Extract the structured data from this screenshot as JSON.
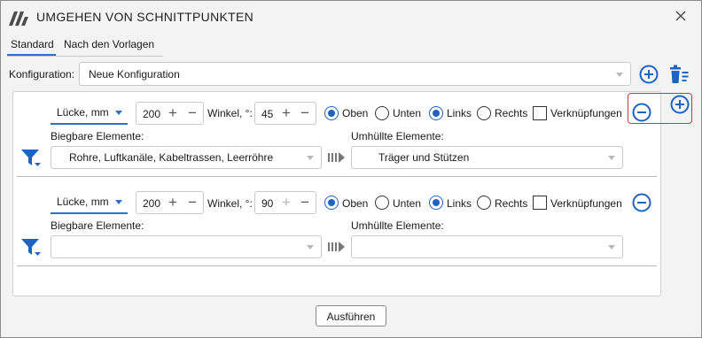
{
  "window": {
    "title": "UMGEHEN VON SCHNITTPUNKTEN"
  },
  "tabs": [
    {
      "label": "Standard"
    },
    {
      "label": "Nach den Vorlagen"
    }
  ],
  "config": {
    "label": "Konfiguration:",
    "value": "Neue Konfiguration"
  },
  "rows": [
    {
      "unit": "Lücke, mm",
      "gap": "200",
      "angle_label": "Winkel, °:",
      "angle": "45",
      "opt_top": "Oben",
      "opt_bottom": "Unten",
      "opt_left": "Links",
      "opt_right": "Rechts",
      "links_label": "Verknüpfungen",
      "bendable_label": "Biegbare Elemente:",
      "bendable_value": "Rohre, Luftkanäle, Kabeltrassen, Leerröhre",
      "wrapped_label": "Umhüllte Elemente:",
      "wrapped_value": "Träger und Stützen",
      "vertical": "top",
      "horizontal": "left",
      "links_checked": false
    },
    {
      "unit": "Lücke, mm",
      "gap": "200",
      "angle_label": "Winkel, °:",
      "angle": "90",
      "opt_top": "Oben",
      "opt_bottom": "Unten",
      "opt_left": "Links",
      "opt_right": "Rechts",
      "links_label": "Verknüpfungen",
      "bendable_label": "Biegbare Elemente:",
      "bendable_value": "",
      "wrapped_label": "Umhüllte Elemente:",
      "wrapped_value": "",
      "vertical": "top",
      "horizontal": "left",
      "links_checked": false
    }
  ],
  "footer": {
    "run_label": "Ausführen"
  },
  "colors": {
    "accent": "#1f62c1",
    "highlight": "#d0343c"
  }
}
